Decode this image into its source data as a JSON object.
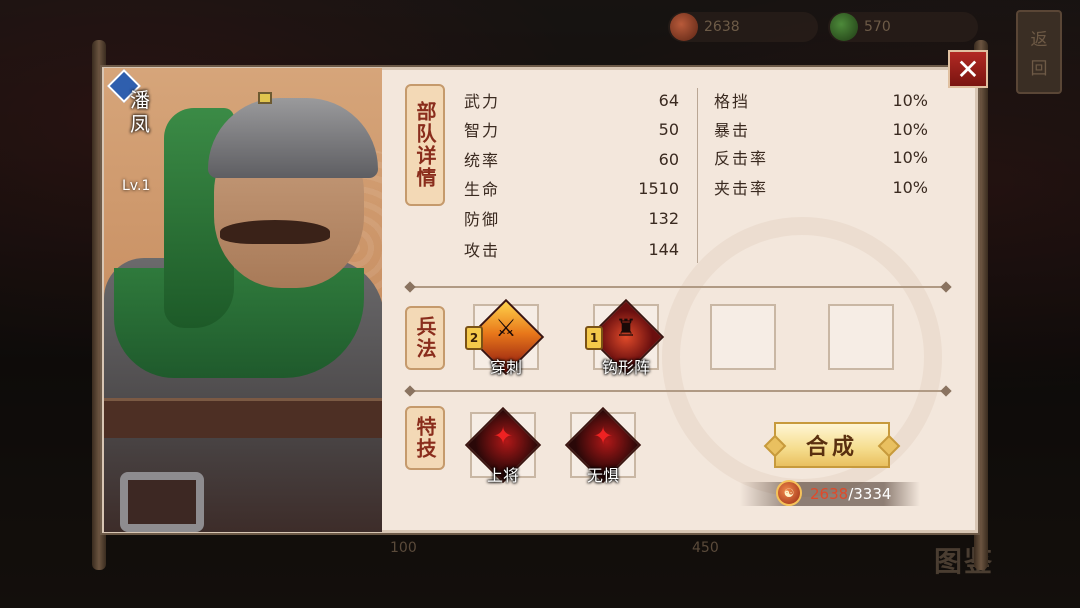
{
  "top_bar": {
    "currency_1": "2638",
    "currency_2": "570"
  },
  "back_button": {
    "char1": "返",
    "char2": "回"
  },
  "background_labels": {
    "left": "100",
    "right": "450"
  },
  "handbook_label": "图鉴",
  "hero": {
    "name": "潘凤",
    "level": "Lv.1"
  },
  "sections": {
    "troops": "部队详情",
    "tactics": "兵法",
    "skills": "特技"
  },
  "stats_left": [
    {
      "label": "武力",
      "value": "64"
    },
    {
      "label": "智力",
      "value": "50"
    },
    {
      "label": "统率",
      "value": "60"
    },
    {
      "label": "生命",
      "value": "1510"
    },
    {
      "label": "防御",
      "value": "132"
    },
    {
      "label": "攻击",
      "value": "144"
    }
  ],
  "stats_right": [
    {
      "label": "格挡",
      "value": "10%"
    },
    {
      "label": "暴击",
      "value": "10%"
    },
    {
      "label": "反击率",
      "value": "10%"
    },
    {
      "label": "夹击率",
      "value": "10%"
    }
  ],
  "tactics": [
    {
      "name": "穿刺",
      "level": "2",
      "icon": "spear-icon"
    },
    {
      "name": "钩形阵",
      "level": "1",
      "icon": "formation-icon"
    }
  ],
  "skills": [
    {
      "name": "上将",
      "icon": "general-icon"
    },
    {
      "name": "无惧",
      "icon": "fearless-icon"
    }
  ],
  "synthesize_button": "合成",
  "fragments": {
    "have": "2638",
    "separator_need": "/3334"
  },
  "close_symbol": "✕",
  "colors": {
    "panel": "#f3e7dc",
    "accent_red": "#8a2d1c",
    "fragment_have": "#e04a2a",
    "close_button": "#b22a24",
    "button_gold": "#f5dc8c"
  }
}
